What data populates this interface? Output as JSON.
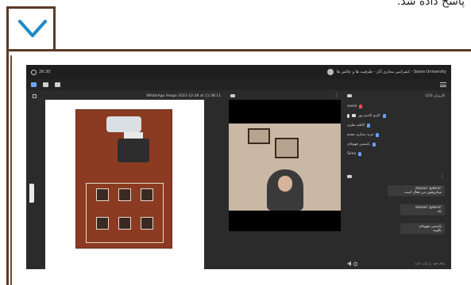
{
  "top_caption": "پاسخ داده شد.",
  "meeting": {
    "time": "26:30",
    "title": "Soore University - کنفرانس مجازی آثار - ظرفیت ها و چالش ها",
    "document": {
      "title": "WhatsApp Image 2021-12-28 at 11:38:11"
    },
    "users_panel": {
      "title": "کاربران (23)",
      "users": [
        {
          "name": "soore",
          "status": "red"
        },
        {
          "name": "اکرم کاسم پور",
          "status": "blue"
        },
        {
          "name": "کاظم نظری",
          "status": "blue"
        },
        {
          "name": "فرید ستاری مقدم",
          "status": "blue"
        },
        {
          "name": "یاسمین قهوه‌ای",
          "status": "blue"
        },
        {
          "name": "Sima",
          "status": "blue"
        }
      ]
    },
    "chat": {
      "messages": [
        {
          "author": "'dazaei' gabrie",
          "text": "میکروفون من فعال است"
        },
        {
          "author": "'dazaei' gabrie",
          "text": "بله"
        },
        {
          "author": "یاسمین قهوه‌ای",
          "text": "بگویید"
        }
      ],
      "input_placeholder": "پیام خود را وارد کنید"
    }
  },
  "icons": {
    "chevron": "chevron-down-icon",
    "speaker": "speaker-icon",
    "share": "share-icon",
    "hand": "raise-hand-icon",
    "menu": "menu-icon",
    "gear": "gear-icon",
    "send": "send-icon",
    "emoji": "emoji-icon",
    "mic": "mic-icon",
    "video": "video-icon"
  },
  "colors": {
    "brown_frame": "#5a3a26",
    "chevron_blue": "#1e88c9",
    "meeting_bg": "#2b2b2b",
    "poster": "#8a3b22"
  }
}
